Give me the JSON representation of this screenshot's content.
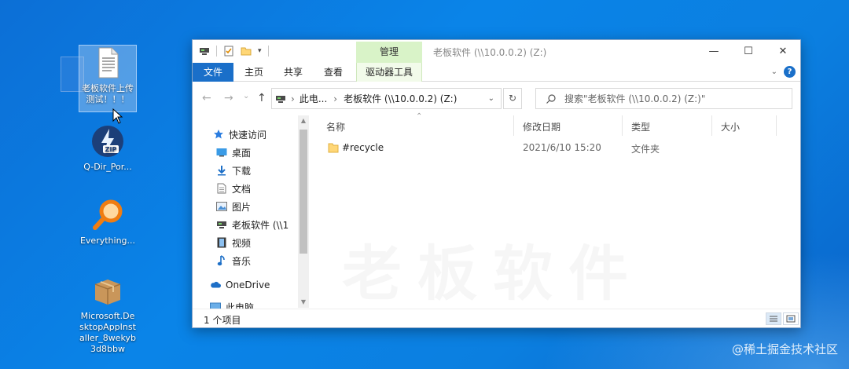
{
  "desktop": {
    "items": [
      {
        "label": "老板软件上传测试！！！",
        "icon": "text-document-icon"
      },
      {
        "label": "Q-Dir_Por...",
        "icon": "zip-icon"
      },
      {
        "label": "Everything...",
        "icon": "magnifier-icon"
      },
      {
        "label": "Microsoft.DesktopAppInstaller_8wekyb3d8bbw",
        "icon": "package-box-icon"
      }
    ],
    "corner_watermark": "@稀土掘金技术社区"
  },
  "window": {
    "title": "老板软件 (\\\\10.0.0.2) (Z:)",
    "contextual_tab": "管理",
    "controls": {
      "minimize": "—",
      "maximize": "☐",
      "close": "✕"
    },
    "ribbon_tabs": [
      "文件",
      "主页",
      "共享",
      "查看",
      "驱动器工具"
    ],
    "address": {
      "root": "此电...",
      "separator": "›",
      "current": "老板软件 (\\\\10.0.0.2) (Z:)"
    },
    "search_placeholder": "搜索\"老板软件 (\\\\10.0.0.2) (Z:)\"",
    "nav": {
      "quick_access": "快速访问",
      "items": [
        "桌面",
        "下载",
        "文档",
        "图片",
        "老板软件 (\\\\1",
        "视频",
        "音乐"
      ],
      "onedrive": "OneDrive",
      "this_pc": "此电脑"
    },
    "columns": [
      "名称",
      "修改日期",
      "类型",
      "大小"
    ],
    "rows": [
      {
        "name": "#recycle",
        "date": "2021/6/10 15:20",
        "type": "文件夹",
        "size": ""
      }
    ],
    "watermark": "老板软件",
    "status": "1 个项目"
  }
}
